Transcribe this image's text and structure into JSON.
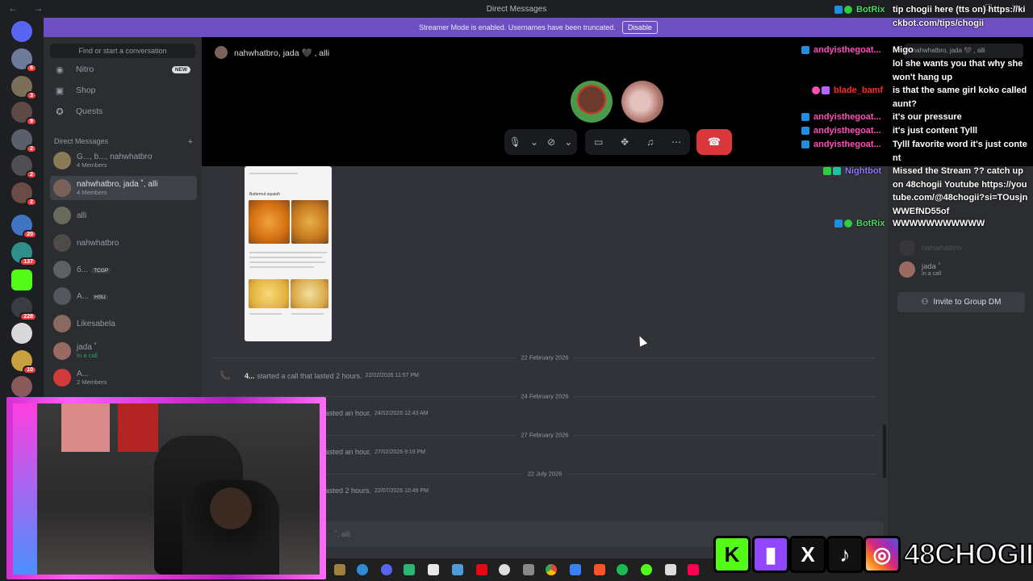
{
  "window": {
    "title": "Direct Messages",
    "nav": "← →",
    "controls": "— ☐ ✕"
  },
  "banner": {
    "text": "Streamer Mode is enabled. Usernames have been truncated.",
    "disable_label": "Disable"
  },
  "servers": [
    {
      "badge": ""
    },
    {
      "badge": "6"
    },
    {
      "badge": "3"
    },
    {
      "badge": "9"
    },
    {
      "badge": "2"
    },
    {
      "badge": "2"
    },
    {
      "badge": "2"
    },
    {
      "badge": "20"
    },
    {
      "badge": "137"
    },
    {
      "badge": ""
    },
    {
      "badge": "228"
    },
    {
      "badge": ""
    },
    {
      "badge": "10"
    },
    {
      "badge": ""
    }
  ],
  "sidebar": {
    "search_placeholder": "Find or start a conversation",
    "nitro": "Nitro",
    "nitro_badge": "NEW",
    "shop": "Shop",
    "quests": "Quests",
    "dm_header": "Direct Messages",
    "add": "+",
    "dms": [
      {
        "name": "G..., b..., nahwhatbro",
        "sub": "4 Members",
        "tag": ""
      },
      {
        "name": "nahwhatbro, jada ˚, alli",
        "sub": "4 Members",
        "tag": ""
      },
      {
        "name": "alli",
        "sub": "",
        "tag": ""
      },
      {
        "name": "nahwhatbro",
        "sub": "",
        "tag": ""
      },
      {
        "name": "б...",
        "sub": "",
        "tag": "TCGP"
      },
      {
        "name": "A...",
        "sub": "",
        "tag": "HSU"
      },
      {
        "name": "Likesabela",
        "sub": "",
        "tag": ""
      },
      {
        "name": "jada ˚",
        "sub": "In a call",
        "tag": ""
      },
      {
        "name": "A...",
        "sub": "2 Members",
        "tag": ""
      }
    ]
  },
  "call": {
    "title": "nahwhatbro, jada 🖤 , alli",
    "hangup": "☎"
  },
  "chat": {
    "dividers": [
      "22 February 2026",
      "24 February 2026",
      "27 February 2026",
      "22 July 2026"
    ],
    "calls": [
      {
        "author": "4...",
        "text": "started a call that lasted 2 hours.",
        "ts": "22/02/2026 11:57 PM"
      },
      {
        "author": "",
        "text": "asted an hour.",
        "ts": "24/02/2026 12:43 AM"
      },
      {
        "author": "",
        "text": "asted an hour.",
        "ts": "27/02/2026 9:19 PM"
      },
      {
        "author": "",
        "text": "asted 2 hours.",
        "ts": "22/07/2026 10:49 PM"
      }
    ],
    "image_card": {
      "heading": "Butternut squash"
    },
    "composer_placeholder": "˚, alli"
  },
  "members": {
    "search": "h nahwhatbro, jada 🖤 , alli",
    "list": [
      {
        "name": "nahwhatbro",
        "sub": ""
      },
      {
        "name": "jada ˚",
        "sub": "In a call"
      }
    ],
    "invite_label": "Invite to Group DM"
  },
  "stream_chat": [
    {
      "user": "BotRix",
      "color": "#4cd964",
      "msg": "tip chogii here (tts on) https://kickbot.com/tips/chogii"
    },
    {
      "user": "",
      "color": "#ffffff",
      "msg": "Migo"
    },
    {
      "user": "andyisthegoat...",
      "color": "#ff4fb8",
      "msg": "lol she wants you that why she won't hang up"
    },
    {
      "user": "blade_bamf",
      "color": "#ff2a2a",
      "msg": "is that the same girl koko called aunt?"
    },
    {
      "user": "andyisthegoat...",
      "color": "#ff4fb8",
      "msg": "it's our pressure"
    },
    {
      "user": "andyisthegoat...",
      "color": "#ff4fb8",
      "msg": "it's just content Tylll"
    },
    {
      "user": "andyisthegoat...",
      "color": "#ff4fb8",
      "msg": "Tylll favorite word it's just content"
    },
    {
      "user": "Nightbot",
      "color": "#8f7cff",
      "msg": "Missed the Stream ?? catch up on 48chogii Youtube https://youtube.com/@48chogii?si=TOusjnWWEfND55of"
    },
    {
      "user": "BotRix",
      "color": "#4cd964",
      "msg": "WWWWWWWWWWW"
    }
  ],
  "socials": {
    "kick": "K",
    "twitch": "▮",
    "x": "X",
    "tiktok": "♪",
    "instagram": "◎",
    "handle": "48CHOGII"
  },
  "colors": {
    "accent": "#5865f2",
    "banner": "#6d4fc1",
    "hangup": "#da373c",
    "online": "#23a55a"
  }
}
